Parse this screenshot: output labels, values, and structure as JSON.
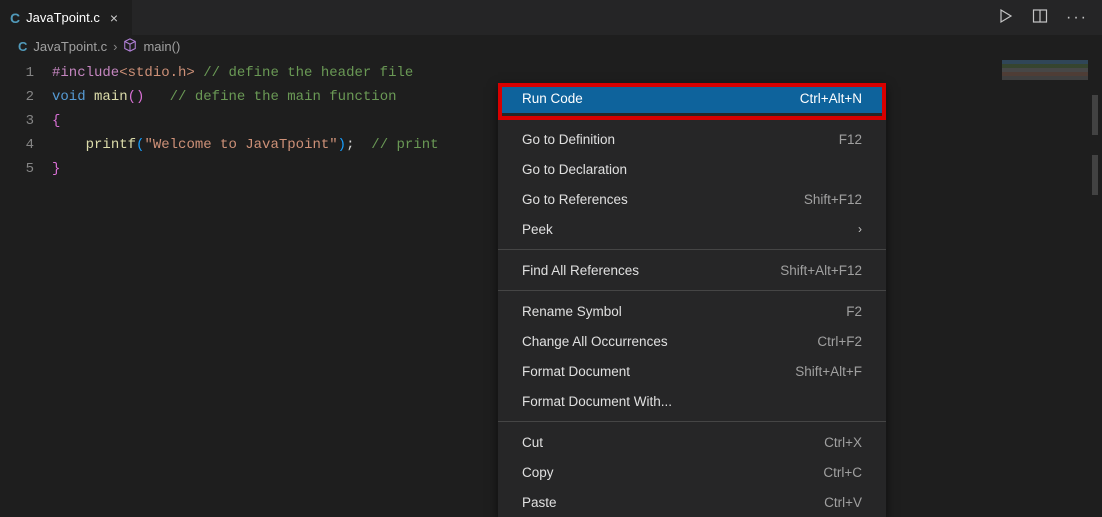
{
  "tab": {
    "icon_letter": "C",
    "filename": "JavaTpoint.c",
    "close_glyph": "×"
  },
  "actions": {
    "run_tooltip": "Run",
    "split_tooltip": "Split Editor",
    "more_glyph": "···"
  },
  "breadcrumb": {
    "icon_letter": "C",
    "file": "JavaTpoint.c",
    "chevron": "›",
    "symbol": "main()"
  },
  "code_lines": [
    {
      "n": "1",
      "seg": {
        "a": "#include",
        "b": "<stdio.h>",
        "c": " // define the header file"
      }
    },
    {
      "n": "2",
      "seg": {
        "a": "void",
        "sp": " ",
        "b": "main",
        "p1": "()",
        "sp2": "   ",
        "c": "// define the main function"
      }
    },
    {
      "n": "3",
      "seg": {
        "a": "{"
      }
    },
    {
      "n": "4",
      "seg": {
        "pad": "    ",
        "a": "printf",
        "p1": "(",
        "s": "\"Welcome to JavaTpoint\"",
        "p2": ")",
        "semi": ";",
        "sp": "  ",
        "c": "// print"
      }
    },
    {
      "n": "5",
      "seg": {
        "a": "}"
      }
    }
  ],
  "context_menu": [
    {
      "label": "Run Code",
      "shortcut": "Ctrl+Alt+N",
      "selected": true
    },
    {
      "sep": true
    },
    {
      "label": "Go to Definition",
      "shortcut": "F12"
    },
    {
      "label": "Go to Declaration",
      "shortcut": ""
    },
    {
      "label": "Go to References",
      "shortcut": "Shift+F12"
    },
    {
      "label": "Peek",
      "shortcut": "",
      "submenu": true
    },
    {
      "sep": true
    },
    {
      "label": "Find All References",
      "shortcut": "Shift+Alt+F12"
    },
    {
      "sep": true
    },
    {
      "label": "Rename Symbol",
      "shortcut": "F2"
    },
    {
      "label": "Change All Occurrences",
      "shortcut": "Ctrl+F2"
    },
    {
      "label": "Format Document",
      "shortcut": "Shift+Alt+F"
    },
    {
      "label": "Format Document With...",
      "shortcut": ""
    },
    {
      "sep": true
    },
    {
      "label": "Cut",
      "shortcut": "Ctrl+X"
    },
    {
      "label": "Copy",
      "shortcut": "Ctrl+C"
    },
    {
      "label": "Paste",
      "shortcut": "Ctrl+V"
    }
  ]
}
